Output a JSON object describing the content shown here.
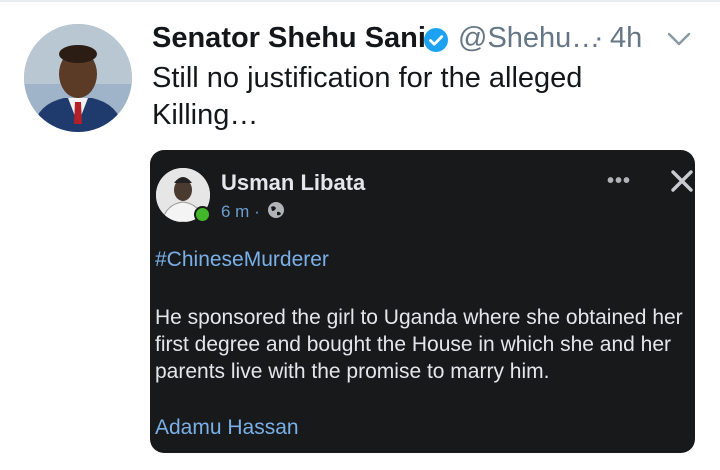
{
  "tweet": {
    "author_name": "Senator Shehu Sani",
    "handle": "@Shehu…",
    "separator": "·",
    "time": "4h",
    "text": "Still no justification for the alleged Killing…"
  },
  "embedded_post": {
    "author": "Usman Libata",
    "time": "6 m",
    "meta_separator": "·",
    "hashtag": "#ChineseMurderer",
    "body": "He sponsored the girl to Uganda where she obtained her first degree and bought the House in which she and her parents live with the promise to marry him.",
    "signature": "Adamu Hassan",
    "more_label": "•••"
  },
  "colors": {
    "verified_badge": "#1da1f2",
    "embed_background": "#18191b",
    "link_blue": "#7ab0e8",
    "online_green": "#42b72a"
  },
  "icons": [
    "verified-badge-icon",
    "chevron-down-icon",
    "globe-icon",
    "more-options-icon",
    "close-icon"
  ]
}
